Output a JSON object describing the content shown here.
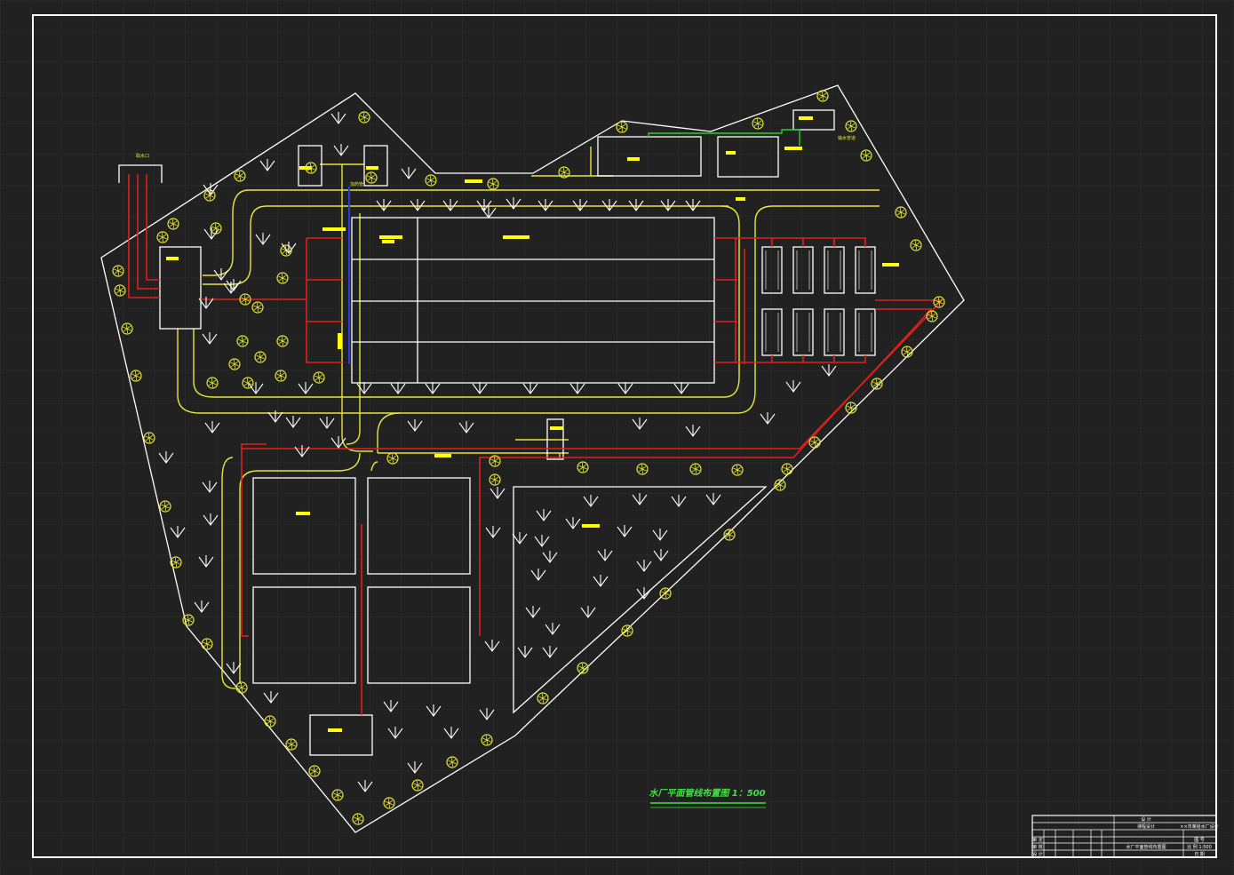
{
  "drawing": {
    "title": "水厂平面管线布置图 1：500",
    "labels": {
      "water_intake": "取水口",
      "pipe_label": "加药管",
      "outlet_label": "输水管道"
    }
  },
  "title_block": {
    "rows": [
      [
        "",
        "",
        "",
        "",
        "",
        "",
        "设 计",
        ""
      ],
      [
        "",
        "",
        "",
        "",
        "",
        "",
        "课程设计",
        "××市某给水厂设计"
      ],
      [
        "",
        "",
        "",
        "",
        "",
        "",
        "",
        ""
      ],
      [
        "审 定",
        "",
        "",
        "",
        "",
        "",
        "",
        "图 号"
      ],
      [
        "审 核",
        "",
        "",
        "",
        "",
        "",
        "水厂平面管线布置图",
        "比 例 1:500"
      ],
      [
        "设 计",
        "",
        "",
        "",
        "",
        "",
        "",
        "日 期"
      ]
    ]
  },
  "colors": {
    "background": "#212121",
    "border": "#ffffff",
    "boundary": "#ffffff",
    "road": "#e6e640",
    "water_pipe": "#e0201a",
    "dosing_pipe": "#2b3bdc",
    "outlet_pipe": "#2bd12b",
    "label_block": "#ffff00",
    "title": "#41e241",
    "tree": "#e8e838"
  }
}
